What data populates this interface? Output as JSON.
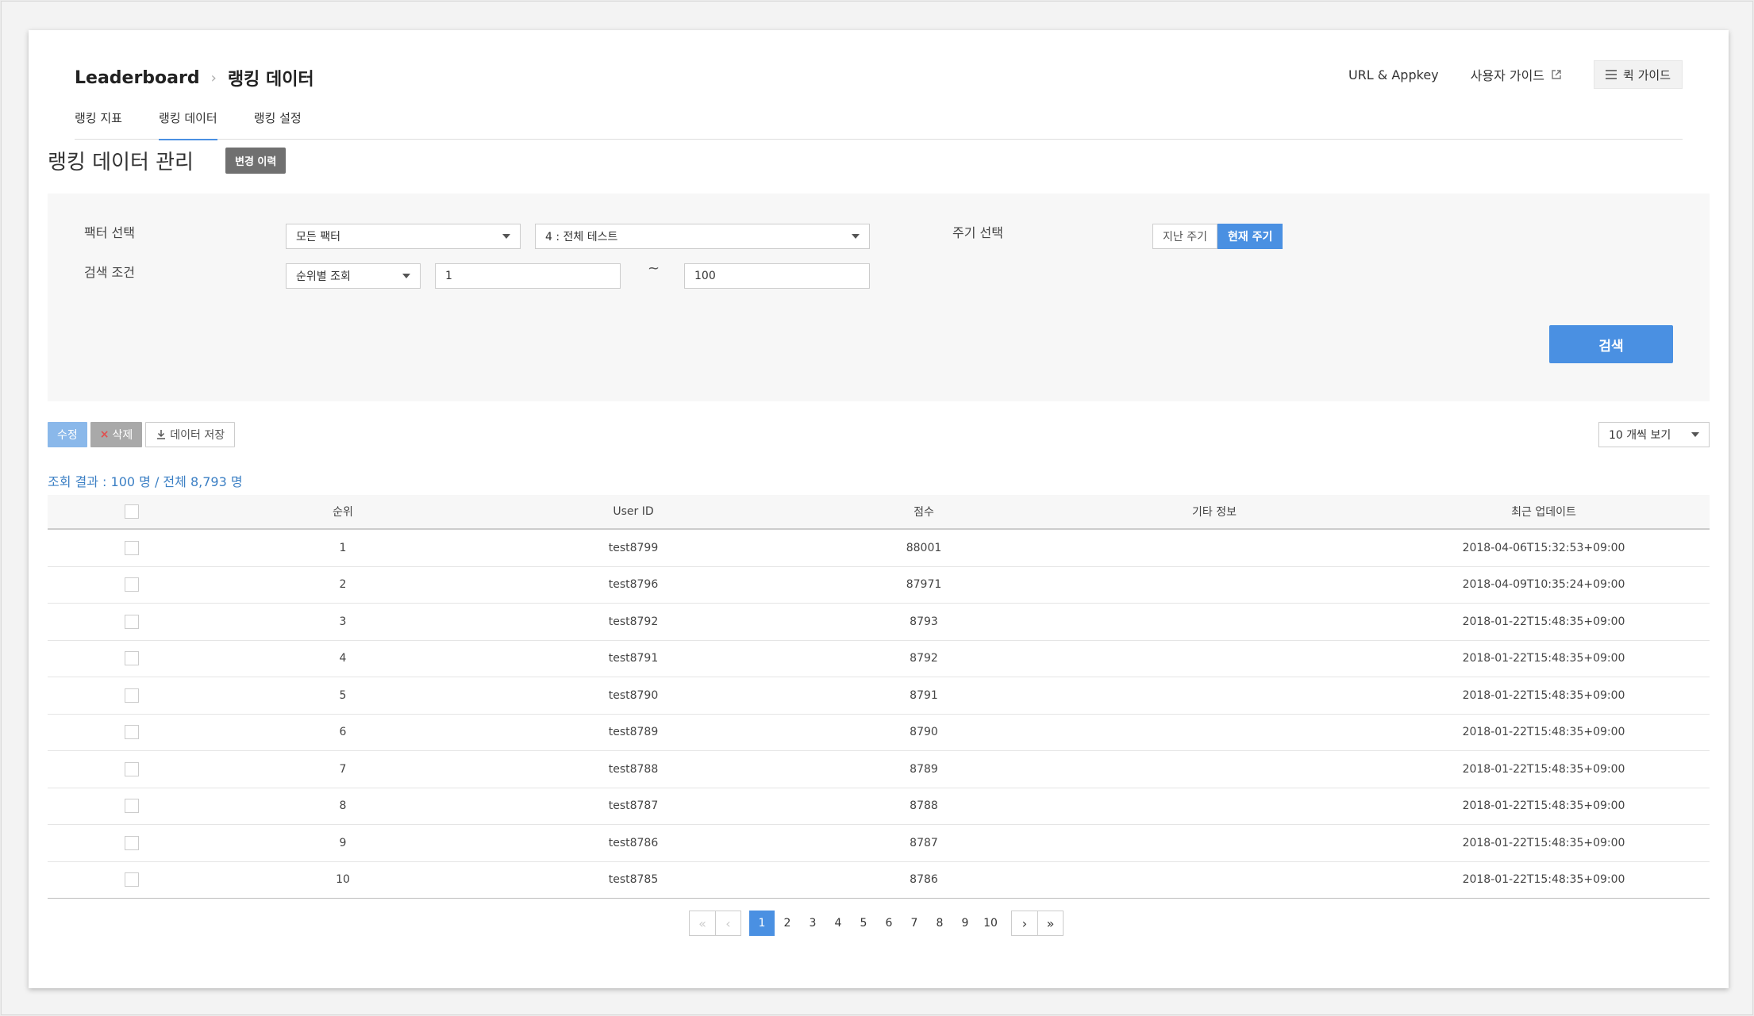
{
  "breadcrumb": {
    "root": "Leaderboard",
    "current": "랭킹 데이터"
  },
  "header_links": {
    "url_appkey": "URL & Appkey",
    "user_guide": "사용자 가이드",
    "quick_guide": "퀵 가이드"
  },
  "tabs": [
    {
      "label": "랭킹 지표"
    },
    {
      "label": "랭킹 데이터"
    },
    {
      "label": "랭킹 설정"
    }
  ],
  "page": {
    "title": "랭킹 데이터 관리",
    "history_button": "변경 이력"
  },
  "filter": {
    "factor_label": "팩터 선택",
    "factor_value": "모든 팩터",
    "leaderboard_value": "4 : 전체 테스트",
    "period_label": "주기 선택",
    "period_options": [
      "지난 주기",
      "현재 주기"
    ],
    "condition_label": "검색 조건",
    "condition_value": "순위별 조회",
    "range_from": "1",
    "range_sep": "~",
    "range_to": "100",
    "search_button": "검색"
  },
  "toolbar": {
    "edit": "수정",
    "delete_x": "×",
    "delete": "삭제",
    "save": "데이터 저장",
    "page_size": "10 개씩 보기"
  },
  "result_text": "조회 결과 : 100 명 / 전체 8,793 명",
  "table": {
    "headers": {
      "rank": "순위",
      "user_id": "User ID",
      "score": "점수",
      "etc": "기타 정보",
      "updated": "최근 업데이트"
    },
    "rows": [
      {
        "rank": "1",
        "user_id": "test8799",
        "score": "88001",
        "etc": "",
        "updated": "2018-04-06T15:32:53+09:00"
      },
      {
        "rank": "2",
        "user_id": "test8796",
        "score": "87971",
        "etc": "",
        "updated": "2018-04-09T10:35:24+09:00"
      },
      {
        "rank": "3",
        "user_id": "test8792",
        "score": "8793",
        "etc": "",
        "updated": "2018-01-22T15:48:35+09:00"
      },
      {
        "rank": "4",
        "user_id": "test8791",
        "score": "8792",
        "etc": "",
        "updated": "2018-01-22T15:48:35+09:00"
      },
      {
        "rank": "5",
        "user_id": "test8790",
        "score": "8791",
        "etc": "",
        "updated": "2018-01-22T15:48:35+09:00"
      },
      {
        "rank": "6",
        "user_id": "test8789",
        "score": "8790",
        "etc": "",
        "updated": "2018-01-22T15:48:35+09:00"
      },
      {
        "rank": "7",
        "user_id": "test8788",
        "score": "8789",
        "etc": "",
        "updated": "2018-01-22T15:48:35+09:00"
      },
      {
        "rank": "8",
        "user_id": "test8787",
        "score": "8788",
        "etc": "",
        "updated": "2018-01-22T15:48:35+09:00"
      },
      {
        "rank": "9",
        "user_id": "test8786",
        "score": "8787",
        "etc": "",
        "updated": "2018-01-22T15:48:35+09:00"
      },
      {
        "rank": "10",
        "user_id": "test8785",
        "score": "8786",
        "etc": "",
        "updated": "2018-01-22T15:48:35+09:00"
      }
    ]
  },
  "pagination": {
    "first": "«",
    "prev": "‹",
    "next": "›",
    "last": "»",
    "pages": [
      "1",
      "2",
      "3",
      "4",
      "5",
      "6",
      "7",
      "8",
      "9",
      "10"
    ],
    "current": "1"
  },
  "colors": {
    "accent": "#4a90e2",
    "result_text": "#3b7fc4"
  }
}
